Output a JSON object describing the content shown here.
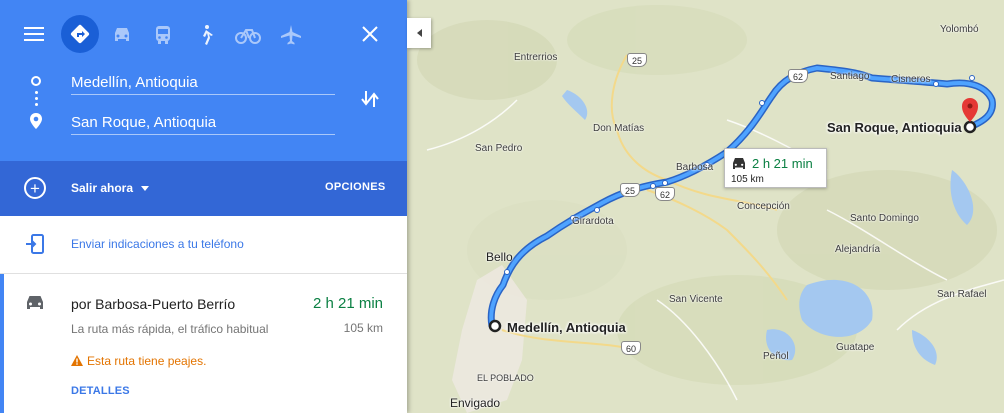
{
  "modes": [
    "Best route",
    "Driving",
    "Transit",
    "Walking",
    "Cycling",
    "Flights"
  ],
  "origin": "Medellín, Antioquia",
  "destination": "San Roque, Antioquia",
  "depart_label": "Salir ahora",
  "options_label": "OPCIONES",
  "send_label": "Enviar indicaciones a tu teléfono",
  "route": {
    "via": "por Barbosa-Puerto Berrío",
    "duration": "2 h 21 min",
    "description": "La ruta más rápida, el tráfico habitual",
    "distance": "105 km",
    "warning": "Esta ruta tiene peajes.",
    "details_label": "DETALLES"
  },
  "map": {
    "tooltip_duration": "2 h 21 min",
    "tooltip_distance": "105 km",
    "origin_label": "Medellín, Antioquia",
    "destination_label": "San Roque, Antioquia",
    "places": {
      "yolombo": "Yolombó",
      "entrerrios": "Entrerrios",
      "santiago": "Santiago",
      "cisneros": "Cisneros",
      "don_matias": "Don Matías",
      "san_pedro": "San Pedro",
      "barbosa": "Barbosa",
      "girardota": "Girardota",
      "concepcion": "Concepción",
      "alejandria": "Alejandría",
      "santo_domingo": "Santo Domingo",
      "bello": "Bello",
      "san_vicente": "San Vicente",
      "san_rafael": "San Rafael",
      "guatape": "Guatape",
      "penol": "Peñol",
      "el_poblado": "EL POBLADO",
      "envigado": "Envigado"
    },
    "shields": {
      "s25_north": "25",
      "s62_top": "62",
      "s25_mid": "25",
      "s62_mid": "62",
      "s60": "60"
    }
  },
  "colors": {
    "header": "#4285f4",
    "header_dark": "#3367d6",
    "route": "#4285f4",
    "duration": "#0b8043",
    "warning": "#e37400"
  }
}
